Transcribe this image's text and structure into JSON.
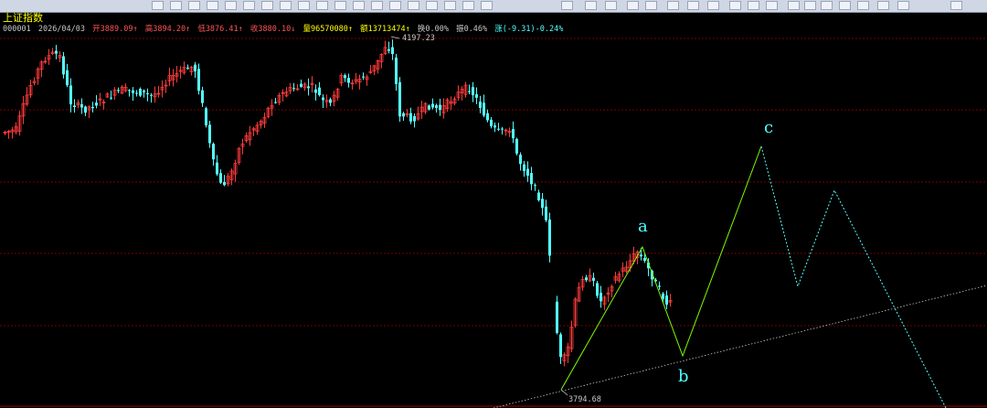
{
  "index_name": "上证指数",
  "info": {
    "code": "000001",
    "date": "2026/04/03",
    "open": "开3889.09↑",
    "high": "高3894.20↑",
    "low": "低3876.41↑",
    "close": "收3880.10↓",
    "volume": "量96570080↑",
    "amount": "额13713474↑",
    "turnover": "换0.00%",
    "amplitude": "振0.46%",
    "change": "涨(-9.31)-0.24%"
  },
  "price_labels": {
    "high_mark": "4197.23",
    "low_mark": "3794.68"
  },
  "wave_labels": [
    "a",
    "b",
    "c"
  ],
  "colors": {
    "up": "#ff3b3b",
    "down": "#54ffff",
    "wave_solid": "#7cfc00",
    "projection": "#54ffff",
    "gridline": "#7a0000",
    "label": "#54ffff"
  },
  "toolbar_icons": [
    "chart-icon",
    "window-icon",
    "window-icon",
    "window-icon",
    "window-icon",
    "window-icon",
    "window-icon",
    "window-icon",
    "window-icon",
    "window-icon",
    "window-icon",
    "window-icon",
    "window-icon",
    "window-icon",
    "window-icon",
    "window-icon",
    "window-icon",
    "window-icon",
    "window-icon",
    "folder-icon",
    "save-icon",
    "crosshair-icon",
    "layout-icon",
    "right-adjust-icon",
    "line-tool-icon",
    "delete-icon",
    "grid-icon",
    "page-icon",
    "table-icon",
    "highlight-icon",
    "delete-tool-icon",
    "settings-icon",
    "window-icon",
    "window-icon",
    "window-icon",
    "window-icon",
    "window-icon",
    "pin-icon"
  ]
}
